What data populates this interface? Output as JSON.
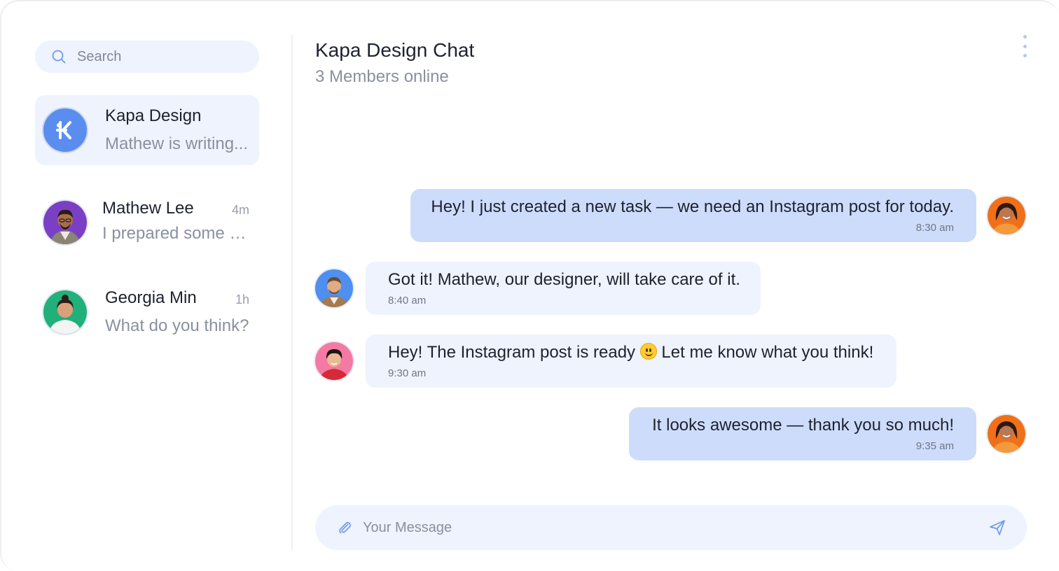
{
  "sidebar": {
    "search": {
      "placeholder": "Search"
    },
    "conversations": [
      {
        "name": "Kapa Design",
        "preview": "Mathew is writing...",
        "time": "",
        "active": true,
        "avatar_icon": "kapa-logo-icon"
      },
      {
        "name": "Mathew Lee",
        "preview": "I prepared some v...",
        "time": "4m",
        "active": false
      },
      {
        "name": "Georgia Min",
        "preview": "What do you think?",
        "time": "1h",
        "active": false
      }
    ]
  },
  "chat": {
    "title": "Kapa Design Chat",
    "subtitle": "3 Members online",
    "messages": [
      {
        "text": "Hey! I just created a new task — we need an Instagram post for today.",
        "time": "8:30 am",
        "direction": "out"
      },
      {
        "text": "Got it! Mathew, our designer, will take care of it.",
        "time": "8:40 am",
        "direction": "in"
      },
      {
        "text_before": "Hey! The Instagram post is ready",
        "text_after": "Let me know what you think!",
        "emoji": "smiling-face-icon",
        "time": "9:30 am",
        "direction": "in"
      },
      {
        "text": "It looks awesome — thank you so much!",
        "time": "9:35 am",
        "direction": "out"
      }
    ]
  },
  "composer": {
    "placeholder": "Your Message"
  },
  "colors": {
    "accent": "#5b8def",
    "bubble_out": "#cddcfa",
    "bubble_in": "#eef3fd",
    "muted_text": "#8a90a0"
  }
}
